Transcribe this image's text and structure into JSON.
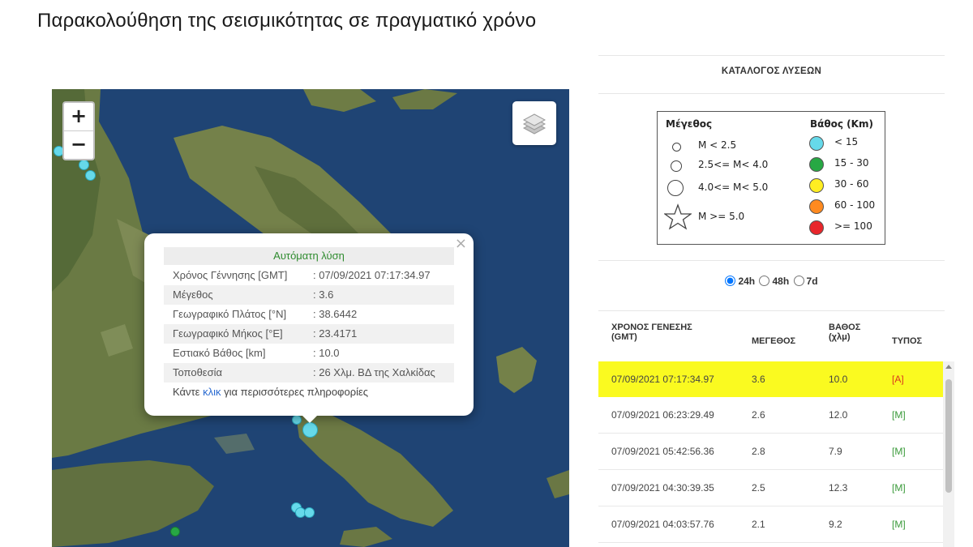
{
  "page": {
    "title": "Παρακολούθηση της σεισμικότητας σε πραγματικό χρόνο"
  },
  "map": {
    "zoom_in": "+",
    "zoom_out": "−",
    "layers_icon": "layers-icon",
    "popup": {
      "header": "Αυτόματη λύση",
      "close": "×",
      "rows": [
        {
          "label": "Χρόνος Γέννησης [GMT]",
          "value": ": 07/09/2021 07:17:34.97"
        },
        {
          "label": "Μέγεθος",
          "value": ": 3.6"
        },
        {
          "label": "Γεωγραφικό Πλάτος [°N]",
          "value": ": 38.6442"
        },
        {
          "label": "Γεωγραφικό Μήκος [°E]",
          "value": ": 23.4171"
        },
        {
          "label": "Εστιακό Βάθος [km]",
          "value": ": 10.0"
        },
        {
          "label": "Τοποθεσία",
          "value": ": 26 Χλμ. ΒΔ της Χαλκίδας"
        }
      ],
      "footer_pre": "Κάντε ",
      "footer_link": "κλικ",
      "footer_post": " για περισσότερες πληροφορίες"
    }
  },
  "catalog": {
    "title": "ΚΑΤΑΛΟΓΟΣ ΛΥΣΕΩΝ",
    "legend": {
      "magnitude_header": "Μέγεθος",
      "depth_header": "Βάθος (Km)",
      "magnitudes": [
        "M < 2.5",
        "2.5<= M< 4.0",
        "4.0<= M< 5.0",
        "M >= 5.0"
      ],
      "depths": [
        {
          "label": "< 15",
          "color": "#66d9ea"
        },
        {
          "label": "15 - 30",
          "color": "#27a844"
        },
        {
          "label": "30 - 60",
          "color": "#ffee22"
        },
        {
          "label": "60 - 100",
          "color": "#ff8a1f"
        },
        {
          "label": ">= 100",
          "color": "#e8262b"
        }
      ]
    },
    "range_options": [
      "24h",
      "48h",
      "7d"
    ],
    "range_selected": "24h",
    "columns": [
      "ΧΡΟΝΟΣ ΓΕΝΕΣΗΣ (GMT)",
      "ΜΕΓΕΘΟΣ",
      "ΒΑΘΟΣ (χλμ)",
      "ΤΥΠΟΣ"
    ],
    "columns_lines": [
      [
        "ΧΡΟΝΟΣ ΓΕΝΕΣΗΣ",
        "(GMT)"
      ],
      [
        "ΜΕΓΕΘΟΣ"
      ],
      [
        "ΒΑΘΟΣ",
        "(χλμ)"
      ],
      [
        "ΤΥΠΟΣ"
      ]
    ],
    "rows": [
      {
        "time": "07/09/2021 07:17:34.97",
        "mag": "3.6",
        "depth": "10.0",
        "type": "[A]"
      },
      {
        "time": "07/09/2021 06:23:29.49",
        "mag": "2.6",
        "depth": "12.0",
        "type": "[M]"
      },
      {
        "time": "07/09/2021 05:42:56.36",
        "mag": "2.8",
        "depth": "7.9",
        "type": "[M]"
      },
      {
        "time": "07/09/2021 04:30:39.35",
        "mag": "2.5",
        "depth": "12.3",
        "type": "[M]"
      },
      {
        "time": "07/09/2021 04:03:57.76",
        "mag": "2.1",
        "depth": "9.2",
        "type": "[M]"
      }
    ],
    "highlight_color": "#fafa20"
  }
}
